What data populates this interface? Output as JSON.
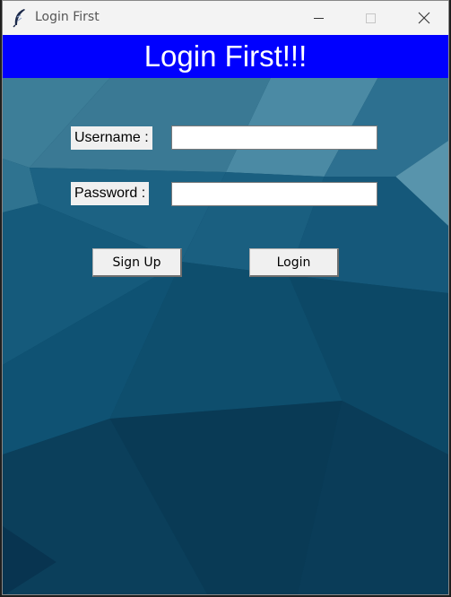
{
  "window": {
    "title": "Login First"
  },
  "header": {
    "title": "Login First!!!",
    "bg_color": "#0000ff",
    "text_color": "#ffffff"
  },
  "form": {
    "username_label": "Username :",
    "username_value": "",
    "password_label": "Password :",
    "password_value": ""
  },
  "actions": {
    "signup_label": "Sign Up",
    "login_label": "Login"
  },
  "icons": {
    "app": "feather-icon",
    "minimize": "minimize-icon",
    "maximize": "maximize-icon",
    "close": "close-icon"
  }
}
